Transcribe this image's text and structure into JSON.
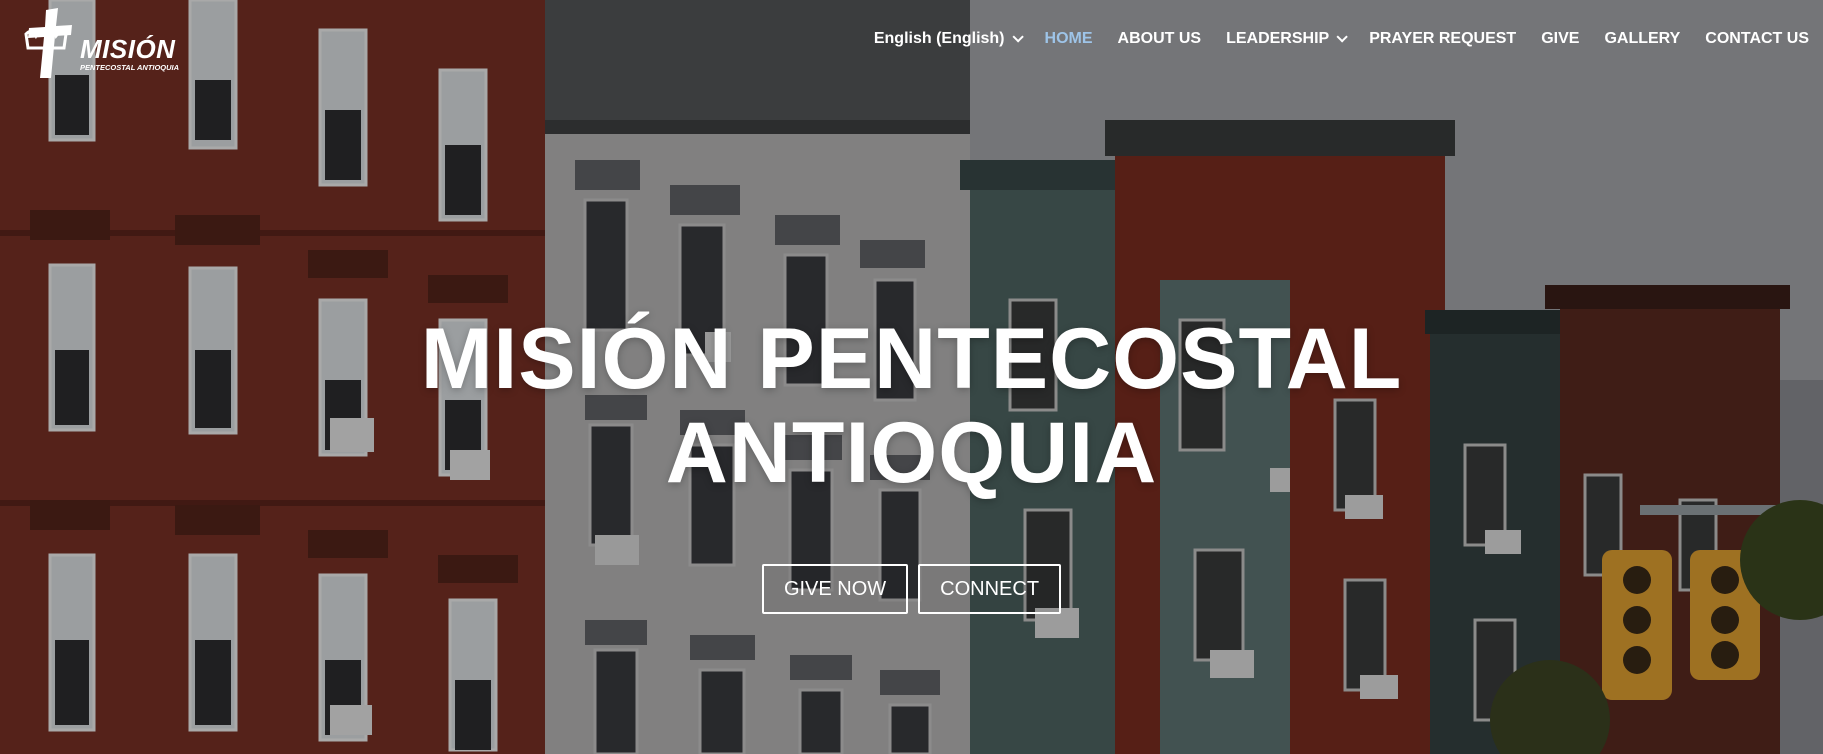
{
  "logo": {
    "title": "MISIÓN",
    "subtitle": "PENTECOSTAL ANTIOQUIA"
  },
  "nav": {
    "items": [
      {
        "label": "English (English)",
        "dropdown": true,
        "active": false
      },
      {
        "label": "HOME",
        "dropdown": false,
        "active": true
      },
      {
        "label": "ABOUT US",
        "dropdown": false,
        "active": false
      },
      {
        "label": "LEADERSHIP",
        "dropdown": true,
        "active": false
      },
      {
        "label": "PRAYER REQUEST",
        "dropdown": false,
        "active": false
      },
      {
        "label": "GIVE",
        "dropdown": false,
        "active": false
      },
      {
        "label": "GALLERY",
        "dropdown": false,
        "active": false
      },
      {
        "label": "CONTACT US",
        "dropdown": false,
        "active": false
      }
    ]
  },
  "hero": {
    "title_line1": "MISIÓN PENTECOSTAL",
    "title_line2": "ANTIOQUIA",
    "give_button": "GIVE NOW",
    "connect_button": "CONNECT"
  },
  "colors": {
    "active_nav": "#9ec4e8",
    "text": "#ffffff"
  }
}
